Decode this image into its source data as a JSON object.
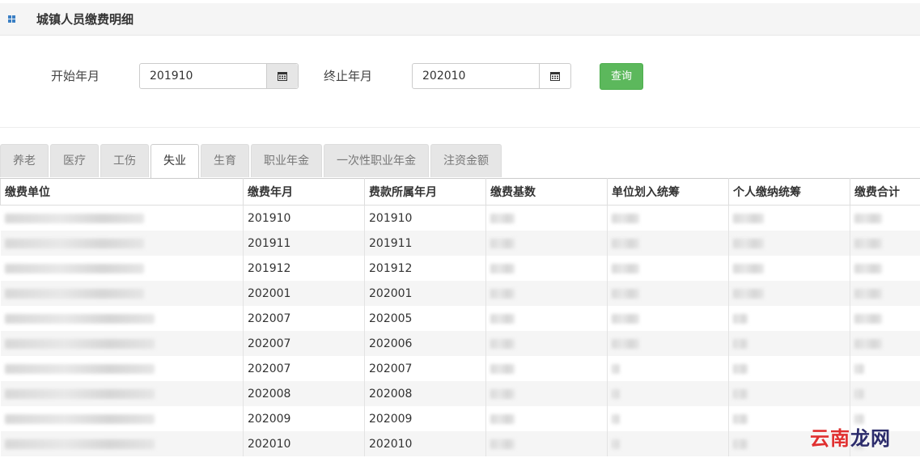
{
  "header": {
    "title": "城镇人员缴费明细"
  },
  "form": {
    "start_label": "开始年月",
    "start_value": "201910",
    "end_label": "终止年月",
    "end_value": "202010",
    "query_label": "查询"
  },
  "tabs": [
    {
      "label": "养老",
      "active": false
    },
    {
      "label": "医疗",
      "active": false
    },
    {
      "label": "工伤",
      "active": false
    },
    {
      "label": "失业",
      "active": true
    },
    {
      "label": "生育",
      "active": false
    },
    {
      "label": "职业年金",
      "active": false
    },
    {
      "label": "一次性职业年金",
      "active": false
    },
    {
      "label": "注资金额",
      "active": false
    }
  ],
  "table": {
    "columns": [
      "缴费单位",
      "缴费年月",
      "费款所属年月",
      "缴费基数",
      "单位划入统筹",
      "个人缴纳统筹",
      "缴费合计"
    ],
    "rows": [
      {
        "pay_month": "201910",
        "belong_month": "201910"
      },
      {
        "pay_month": "201911",
        "belong_month": "201911"
      },
      {
        "pay_month": "201912",
        "belong_month": "201912"
      },
      {
        "pay_month": "202001",
        "belong_month": "202001"
      },
      {
        "pay_month": "202007",
        "belong_month": "202005"
      },
      {
        "pay_month": "202007",
        "belong_month": "202006"
      },
      {
        "pay_month": "202007",
        "belong_month": "202007"
      },
      {
        "pay_month": "202008",
        "belong_month": "202008"
      },
      {
        "pay_month": "202009",
        "belong_month": "202009"
      },
      {
        "pay_month": "202010",
        "belong_month": "202010"
      }
    ]
  },
  "watermark": {
    "text_red": "云南",
    "text_dark": "龙网"
  },
  "colors": {
    "query_button": "#5cb85c",
    "header_bg": "#f5f5f5"
  }
}
